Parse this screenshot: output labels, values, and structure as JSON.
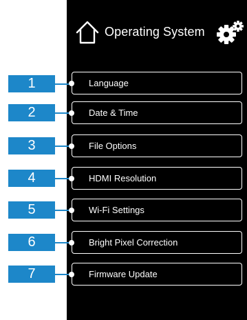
{
  "header": {
    "title": "Operating System",
    "left_icon": "home-icon",
    "right_icon": "gear-icon"
  },
  "menu": [
    {
      "number": "1",
      "label": "Language"
    },
    {
      "number": "2",
      "label": "Date & Time"
    },
    {
      "number": "3",
      "label": "File Options"
    },
    {
      "number": "4",
      "label": "HDMI Resolution"
    },
    {
      "number": "5",
      "label": "Wi-Fi Settings"
    },
    {
      "number": "6",
      "label": "Bright Pixel Correction"
    },
    {
      "number": "7",
      "label": "Firmware Update"
    }
  ],
  "colors": {
    "panel_background": "#000000",
    "callout_blue": "#1d87c9",
    "text": "#ffffff"
  }
}
